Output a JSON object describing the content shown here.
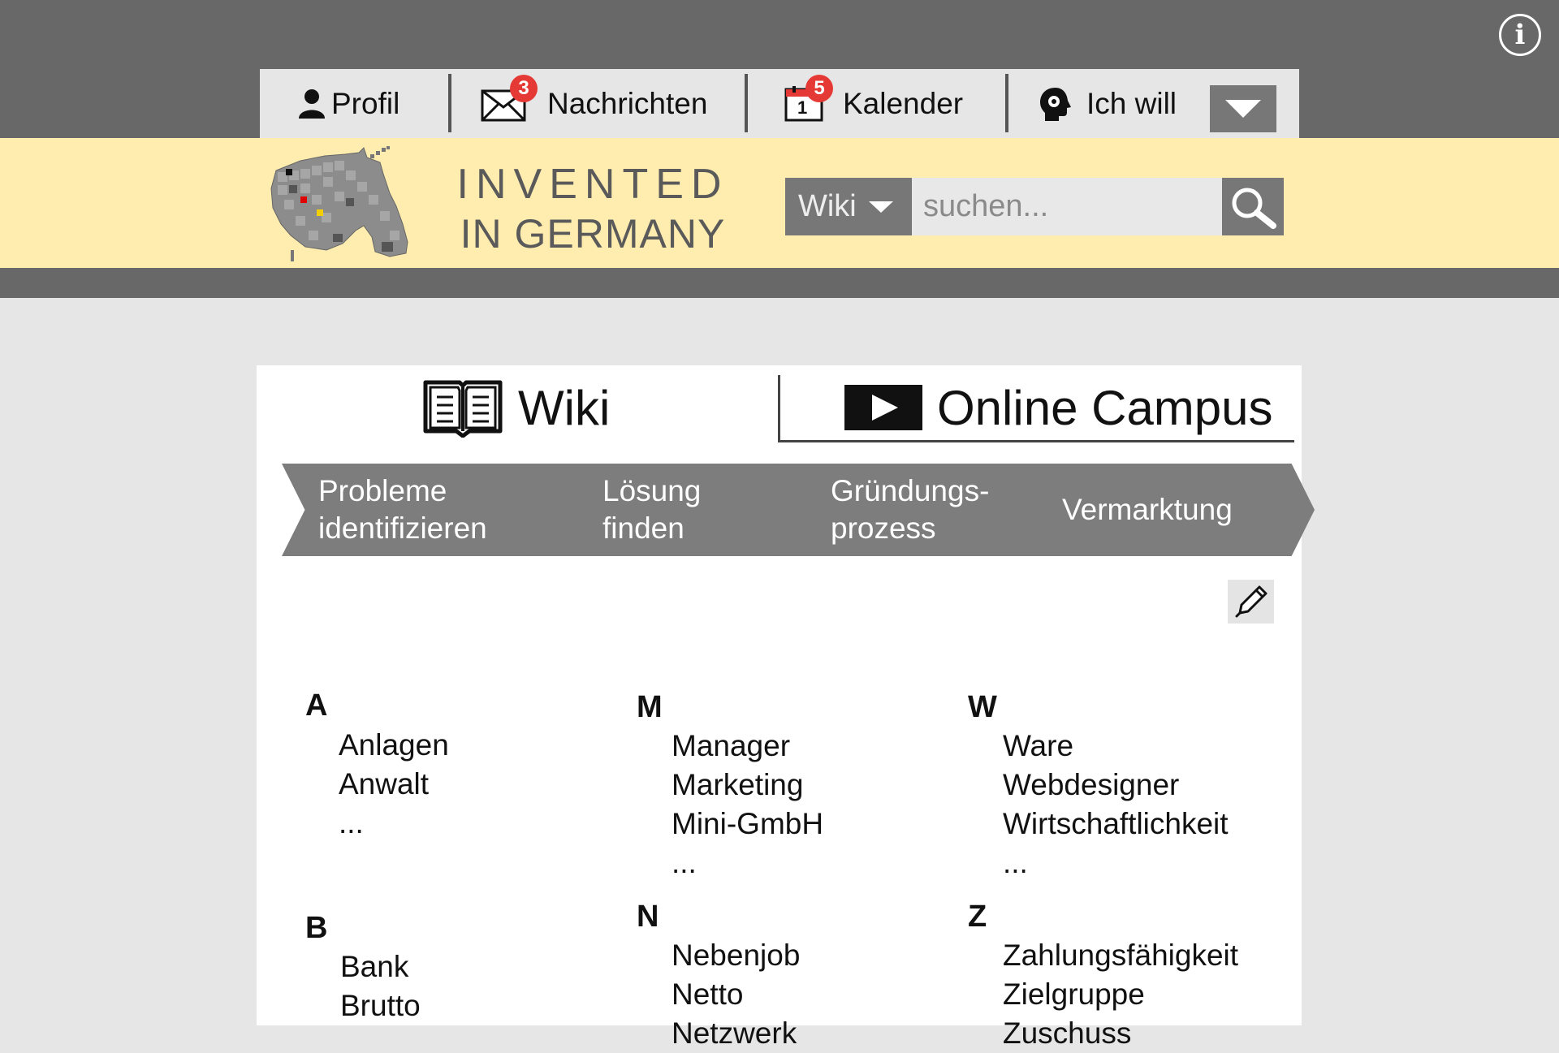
{
  "info": {
    "label": "i"
  },
  "nav": {
    "items": [
      {
        "label": "Profil",
        "icon": "person-icon"
      },
      {
        "label": "Nachrichten",
        "icon": "envelope-icon",
        "badge": "3"
      },
      {
        "label": "Kalender",
        "icon": "calendar-icon",
        "badge": "5",
        "calendar_day": "1"
      },
      {
        "label": "Ich will",
        "icon": "head-gear-icon"
      }
    ]
  },
  "brand": {
    "line1": "INVENTED",
    "line2": "IN GERMANY"
  },
  "search": {
    "scope": "Wiki",
    "placeholder": "suchen..."
  },
  "tabs": [
    {
      "label": "Wiki",
      "icon": "book-icon",
      "active": true
    },
    {
      "label": "Online Campus",
      "icon": "play-icon",
      "active": false
    }
  ],
  "steps": [
    {
      "line1": "Probleme",
      "line2": "identifizieren"
    },
    {
      "line1": "Lösung",
      "line2": "finden"
    },
    {
      "line1": "Gründungs-",
      "line2": "prozess"
    },
    {
      "line1": "Vermarktung",
      "line2": ""
    }
  ],
  "glossary": {
    "A": {
      "letter": "A",
      "entries": [
        "Anlagen",
        "Anwalt",
        "..."
      ]
    },
    "B": {
      "letter": "B",
      "entries": [
        "Bank",
        "Brutto"
      ]
    },
    "M": {
      "letter": "M",
      "entries": [
        "Manager",
        "Marketing",
        "Mini-GmbH",
        "..."
      ]
    },
    "N": {
      "letter": "N",
      "entries": [
        "Nebenjob",
        "Netto",
        "Netzwerk"
      ]
    },
    "W": {
      "letter": "W",
      "entries": [
        "Ware",
        "Webdesigner",
        "Wirtschaftlichkeit",
        "..."
      ]
    },
    "Z": {
      "letter": "Z",
      "entries": [
        "Zahlungsfähigkeit",
        "Zielgruppe",
        "Zuschuss"
      ]
    }
  },
  "colors": {
    "dark_band": "#686868",
    "yellow_band": "#ffedaf",
    "badge": "#e53935",
    "step": "#7d7d7d"
  }
}
